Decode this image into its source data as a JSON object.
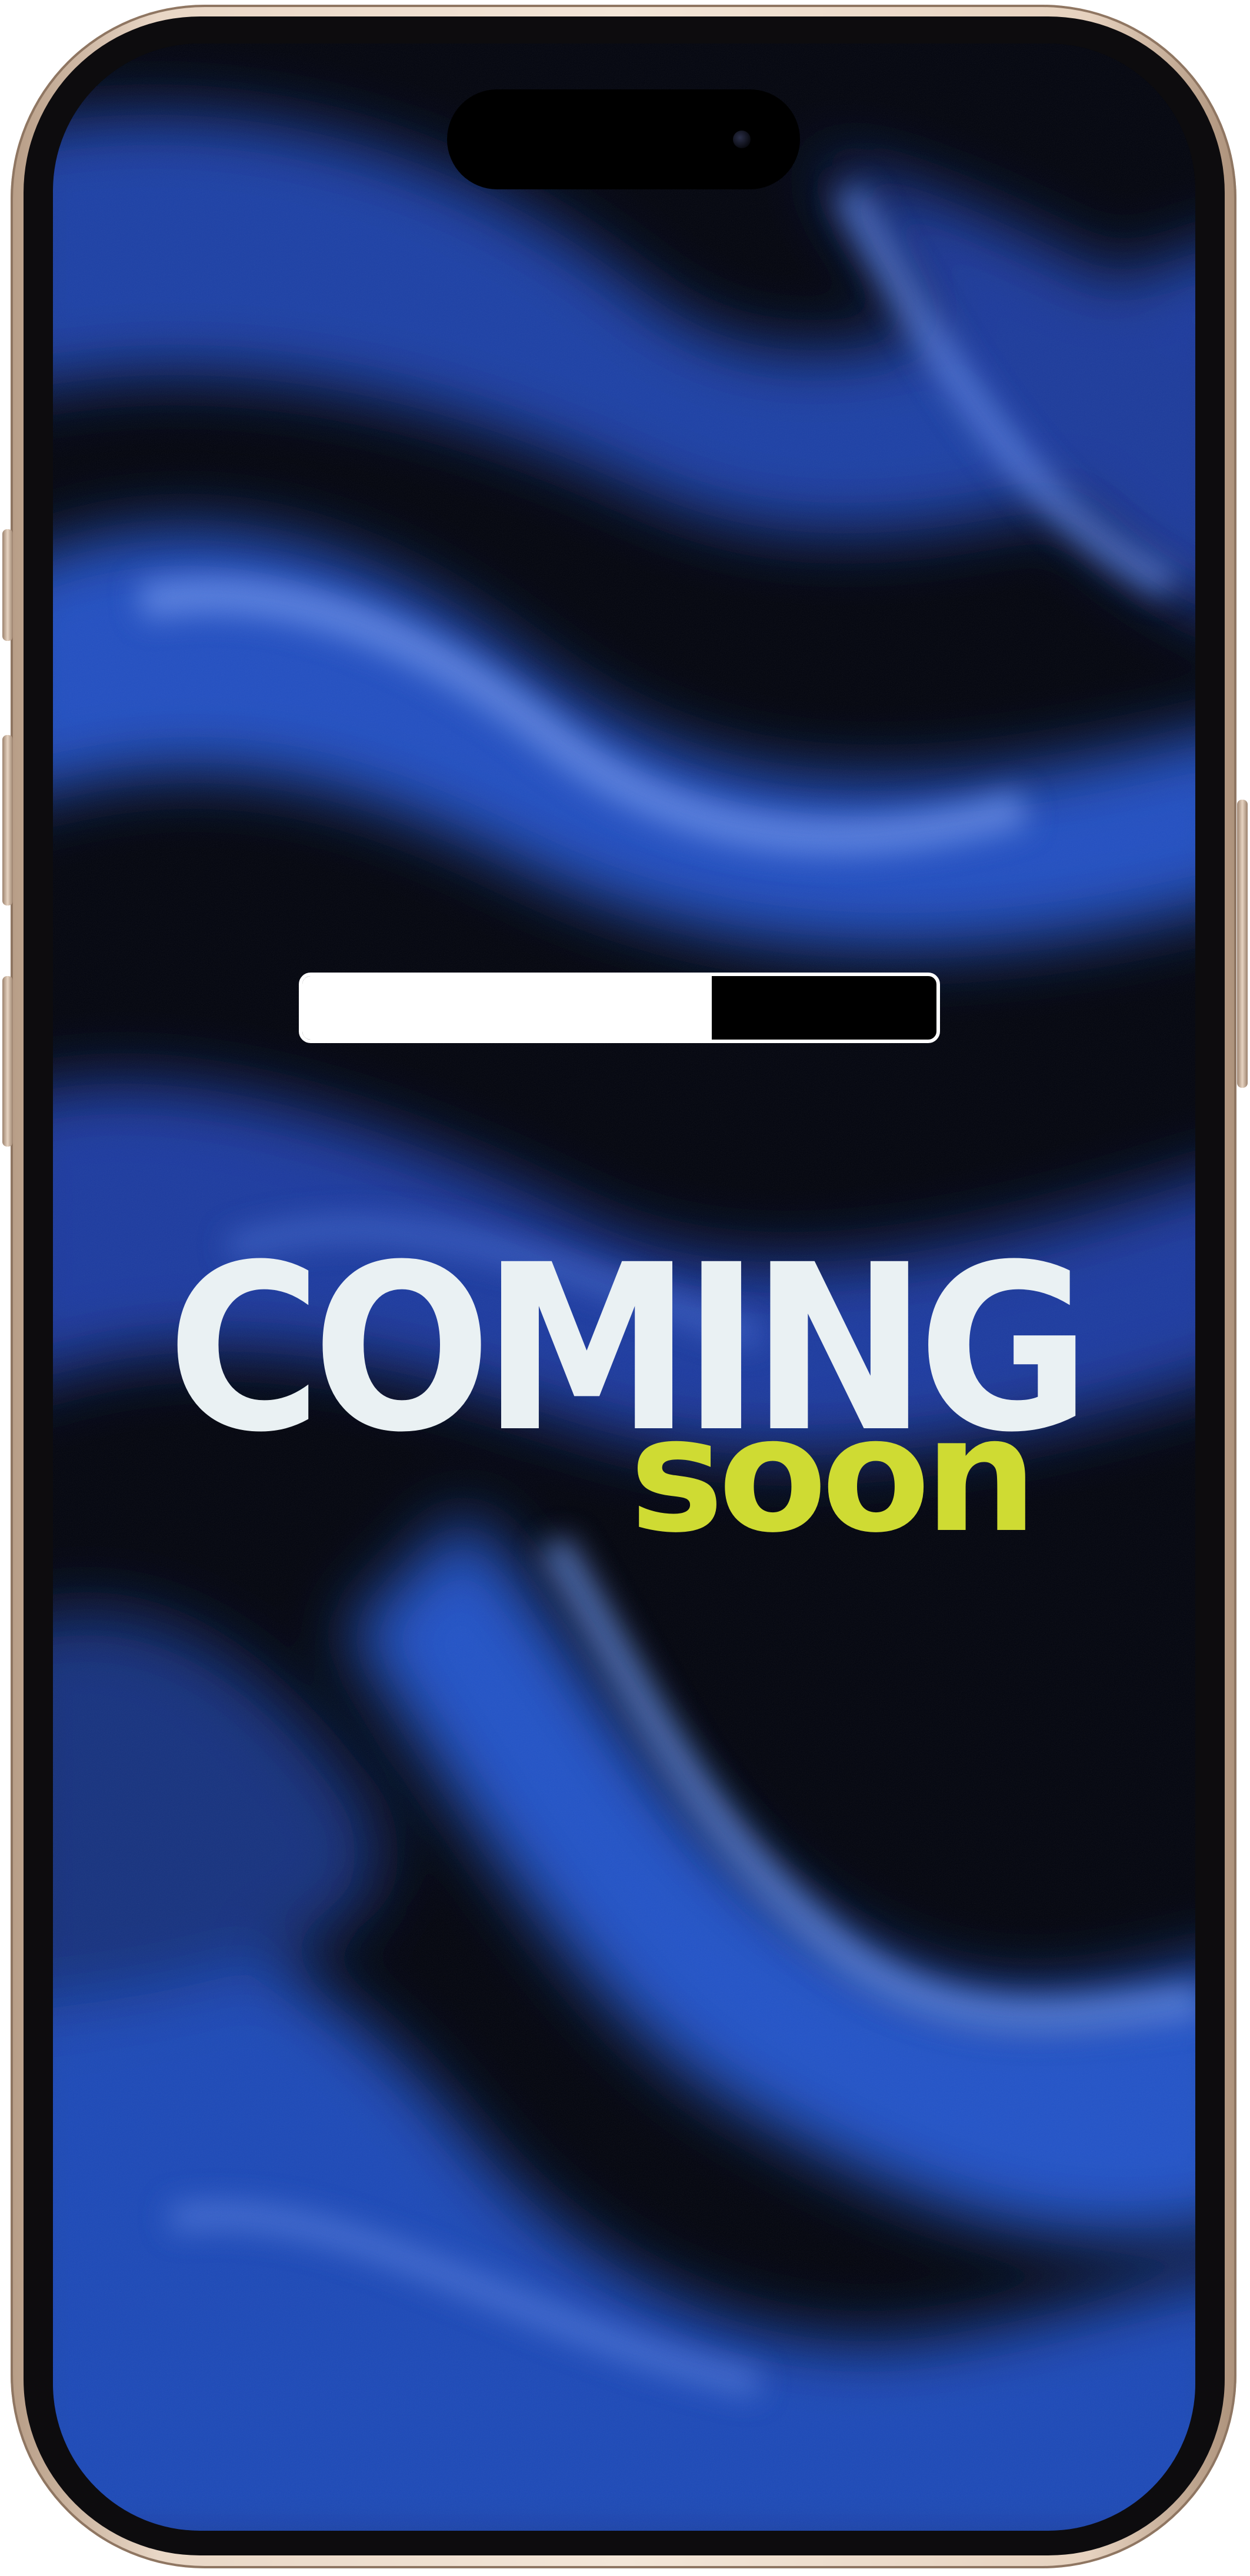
{
  "device": {
    "frame_color": "#e9d7c6",
    "screen_background": "#02040d"
  },
  "splash": {
    "headline": "COMING",
    "subheadline": "soon",
    "headline_color": "#eaf1f3",
    "subheadline_color": "#cfdb33",
    "accent_fabric_color": "#2a55c8"
  },
  "progress": {
    "percent": 64
  }
}
